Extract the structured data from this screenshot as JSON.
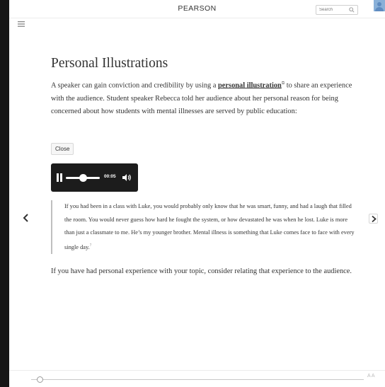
{
  "header": {
    "brand": "PEARSON",
    "search_placeholder": "Search"
  },
  "content": {
    "title": "Personal Illustrations",
    "paragraph1_before": "A speaker can gain conviction and credibility by using a ",
    "paragraph1_link": "personal illustration",
    "paragraph1_link_marker": "⧉",
    "paragraph1_after": " to share an experience with the audience. Student speaker Rebecca told her audience about her personal reason for being concerned about how students with mental illnesses are served by public education:",
    "close_button": "Close",
    "quote_text": "If you had been in a class with Luke, you would probably only know that he was smart, funny, and had a laugh that filled the room. You would never guess how hard he fought the system, or how devastated he was when he lost. Luke is more than just a classmate to me. He’s my younger brother. Mental illness is something that Luke comes face to face with every single day.",
    "quote_footnote": "7",
    "paragraph2": "If you have had personal experience with your topic, consider relating that experience to the audience."
  },
  "audio_player": {
    "time": "00:05",
    "progress": 0.5
  },
  "footer": {
    "font_size_label": "A A",
    "page_slider_position": 0.02
  },
  "icons": [
    "menu-icon",
    "search-icon",
    "user-avatar-icon",
    "pause-icon",
    "volume-icon",
    "chevron-left-icon",
    "chevron-right-icon"
  ]
}
